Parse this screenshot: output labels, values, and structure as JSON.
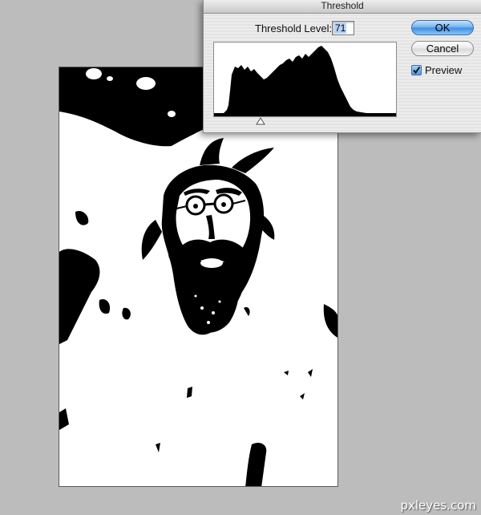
{
  "dialog": {
    "title": "Threshold",
    "threshold_label": "Threshold Level:",
    "threshold_value": "71",
    "ok_label": "OK",
    "cancel_label": "Cancel",
    "preview_label": "Preview",
    "preview_checked": true
  },
  "document": {
    "image_description_icon": "threshold-portrait-image"
  },
  "watermark": "pxleyes.com",
  "colors": {
    "workspace": "#bcbcbc",
    "accent_button": "#3d8fe3",
    "selection": "#b6d2f5"
  }
}
